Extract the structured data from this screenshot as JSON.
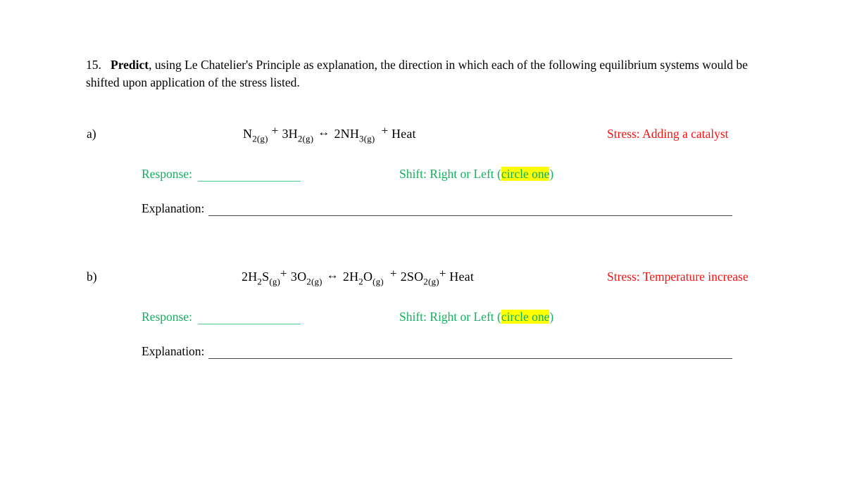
{
  "document": {
    "question": {
      "number": "15.",
      "bold_word": "Predict",
      "text_after_bold": ", using Le Chatelier's Principle as explanation, the direction in which each of the following equilibrium systems would be shifted upon application of the stress listed."
    },
    "labels": {
      "response": "Response:",
      "shift_prefix": "Shift:  Right or Left (",
      "shift_highlight": "circle one",
      "shift_suffix": ")",
      "explanation": "Explanation:",
      "stress_prefix": "Stress:"
    },
    "colors": {
      "stress_red": "#fb1111",
      "response_green": "#13b05e",
      "highlight_yellow": "#ffff00",
      "explanation_black": "#000000",
      "rule_green": "#4cc98c",
      "rule_gray": "#4a4a4a",
      "page_background": "#ffffff"
    },
    "parts": [
      {
        "label": "a)",
        "equation": {
          "plain": "N2(g) + 3H2(g) ↔ 2NH3(g) + Heat",
          "terms": [
            {
              "coefficient": "",
              "formula": "N",
              "subscript": "2(g)"
            },
            {
              "coefficient": "3",
              "formula": "H",
              "subscript": "2(g)"
            }
          ],
          "products": [
            {
              "coefficient": "2",
              "formula": "NH",
              "subscript": "3(g)"
            }
          ],
          "plus": "+",
          "arrow": "↔",
          "heat": "Heat"
        },
        "stress": "Stress:  Adding a catalyst",
        "response_value": "",
        "explanation_value": ""
      },
      {
        "label": "b)",
        "equation": {
          "plain": "2H2S(g) + 3O2(g) ↔ 2H2O(g) + 2SO2(g) + Heat",
          "terms": [
            {
              "coefficient": "2",
              "formula_a": "H",
              "sub_a": "2",
              "formula_b": "S",
              "subscript": "(g)"
            },
            {
              "coefficient": "3",
              "formula": "O",
              "subscript": "2(g)"
            }
          ],
          "products": [
            {
              "coefficient": "2",
              "formula_a": "H",
              "sub_a": "2",
              "formula_b": "O",
              "subscript": "(g)"
            },
            {
              "coefficient": "2",
              "formula": "SO",
              "subscript": "2(g)"
            }
          ],
          "plus": "+",
          "arrow": "↔",
          "heat": "Heat"
        },
        "stress": "Stress:  Temperature increase",
        "response_value": "",
        "explanation_value": ""
      }
    ]
  }
}
